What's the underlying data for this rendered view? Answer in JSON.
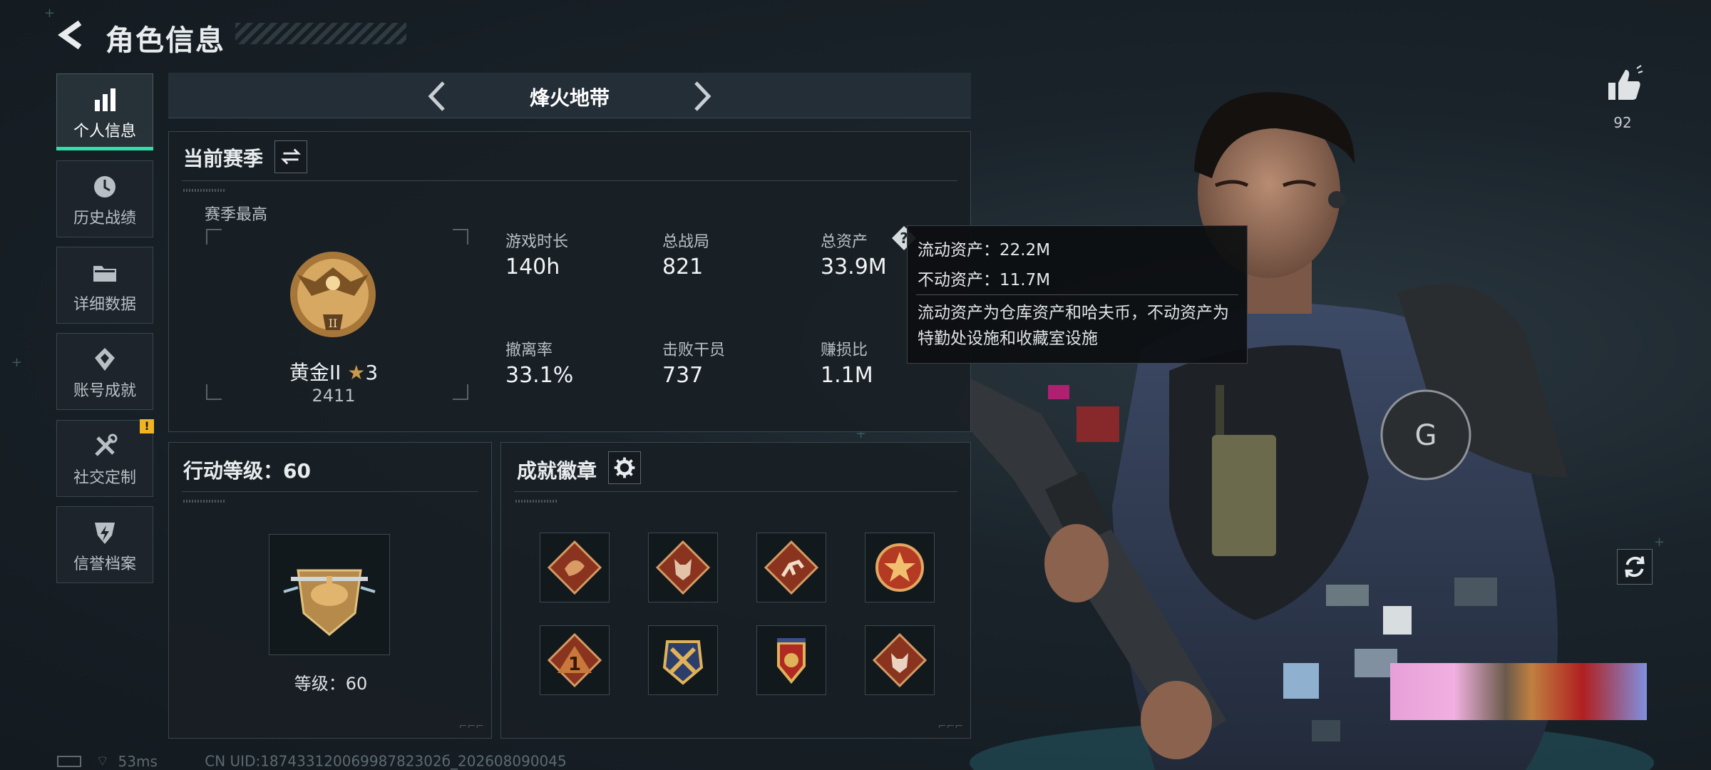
{
  "header": {
    "title": "角色信息"
  },
  "sidebar": {
    "items": [
      {
        "label": "个人信息",
        "icon": "bar-chart-icon",
        "active": true
      },
      {
        "label": "历史战绩",
        "icon": "clock-icon"
      },
      {
        "label": "详细数据",
        "icon": "folder-icon"
      },
      {
        "label": "账号成就",
        "icon": "achievement-icon"
      },
      {
        "label": "社交定制",
        "icon": "tools-icon",
        "badge": "!"
      },
      {
        "label": "信誉档案",
        "icon": "shield-lightning-icon"
      }
    ]
  },
  "mode": {
    "title": "烽火地带"
  },
  "season": {
    "title": "当前赛季",
    "best_label": "赛季最高",
    "rank_name": "黄金II",
    "rank_stars": "3",
    "rank_score": "2411",
    "rank_emblem_numeral": "II",
    "stats": [
      {
        "label": "游戏时长",
        "value": "140h"
      },
      {
        "label": "总战局",
        "value": "821"
      },
      {
        "label": "总资产",
        "value": "33.9M"
      },
      {
        "label": "撤离率",
        "value": "33.1%"
      },
      {
        "label": "击败干员",
        "value": "737"
      },
      {
        "label": "赚损比",
        "value": "1.1M"
      }
    ]
  },
  "tooltip": {
    "line1": "流动资产：22.2M",
    "line2": "不动资产：11.7M",
    "desc": "流动资产为仓库资产和哈夫币，不动资产为特勤处设施和收藏室设施"
  },
  "action_level": {
    "title": "行动等级：60",
    "level_text": "等级：60"
  },
  "achievements": {
    "title": "成就徽章",
    "badges": [
      "dragon-badge-icon",
      "wolf-badge-icon",
      "runner-badge-icon",
      "star-medal-icon",
      "number-one-badge-icon",
      "crossed-weapons-badge-icon",
      "crest-badge-icon",
      "wolf-badge-2-icon"
    ]
  },
  "profile": {
    "likes": "92"
  },
  "footer": {
    "ping": "53ms",
    "uid": "CN UID:18743312006998782302б_202608090045"
  },
  "colors": {
    "accent": "#2fe0a8",
    "warning": "#f0b420",
    "gold": "#c89a4a"
  }
}
